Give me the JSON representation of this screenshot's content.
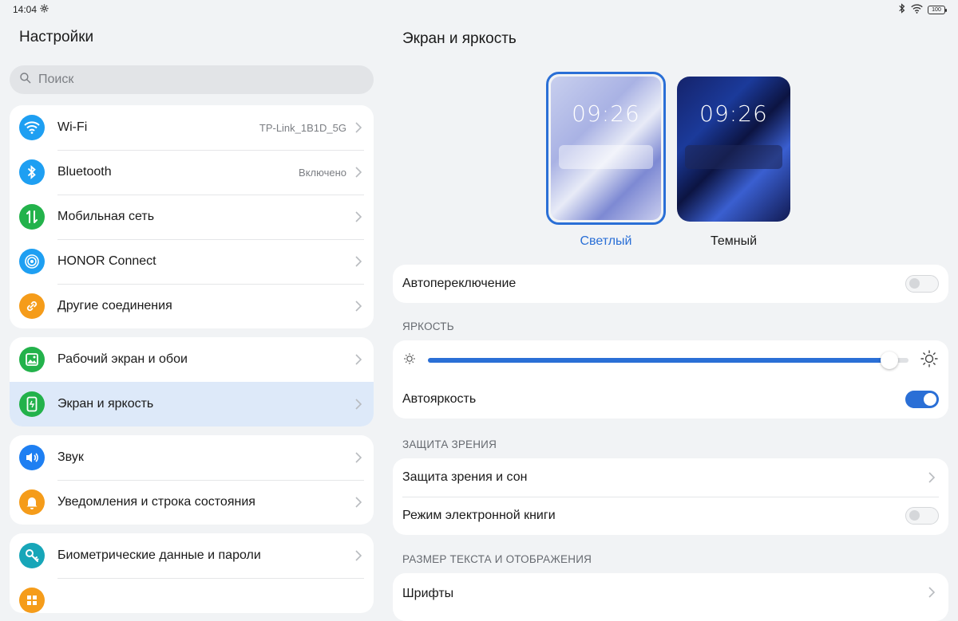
{
  "status_bar": {
    "time": "14:04",
    "battery": "100"
  },
  "left": {
    "title": "Настройки",
    "search_placeholder": "Поиск",
    "groups": [
      [
        {
          "label": "Wi-Fi",
          "value": "TP-Link_1B1D_5G",
          "icon": "wifi-icon",
          "color": "#1e9ff2"
        },
        {
          "label": "Bluetooth",
          "value": "Включено",
          "icon": "bluetooth-icon",
          "color": "#1e9ff2"
        },
        {
          "label": "Мобильная сеть",
          "value": "",
          "icon": "mobile-data-icon",
          "color": "#23b24b"
        },
        {
          "label": "HONOR Connect",
          "value": "",
          "icon": "honor-connect-icon",
          "color": "#1e9ff2"
        },
        {
          "label": "Другие соединения",
          "value": "",
          "icon": "link-icon",
          "color": "#f59c1a"
        }
      ],
      [
        {
          "label": "Рабочий экран и обои",
          "value": "",
          "icon": "wallpaper-icon",
          "color": "#23b24b"
        },
        {
          "label": "Экран и яркость",
          "value": "",
          "icon": "display-icon",
          "color": "#23b24b",
          "selected": true
        }
      ],
      [
        {
          "label": "Звук",
          "value": "",
          "icon": "sound-icon",
          "color": "#1e7ff2"
        },
        {
          "label": "Уведомления и строка состояния",
          "value": "",
          "icon": "bell-icon",
          "color": "#f59c1a"
        }
      ],
      [
        {
          "label": "Биометрические данные и пароли",
          "value": "",
          "icon": "key-icon",
          "color": "#17a6b8"
        },
        {
          "label": "",
          "value": "",
          "icon": "apps-icon",
          "color": "#f59c1a"
        }
      ]
    ]
  },
  "right": {
    "title": "Экран и яркость",
    "theme_light": {
      "time": "09:26",
      "label": "Светлый"
    },
    "theme_dark": {
      "time": "09:26",
      "label": "Темный"
    },
    "auto_switch": "Автопереключение",
    "brightness_header": "ЯРКОСТЬ",
    "brightness_level": 0.96,
    "auto_brightness": "Автояркость",
    "eye_header": "ЗАЩИТА ЗРЕНИЯ",
    "eye_comfort": "Защита зрения и сон",
    "ebook_mode": "Режим электронной книги",
    "text_header": "РАЗМЕР ТЕКСТА И ОТОБРАЖЕНИЯ",
    "fonts": "Шрифты"
  },
  "colors": {
    "accent": "#2a6fd6",
    "selected_row": "#dde9f9"
  }
}
